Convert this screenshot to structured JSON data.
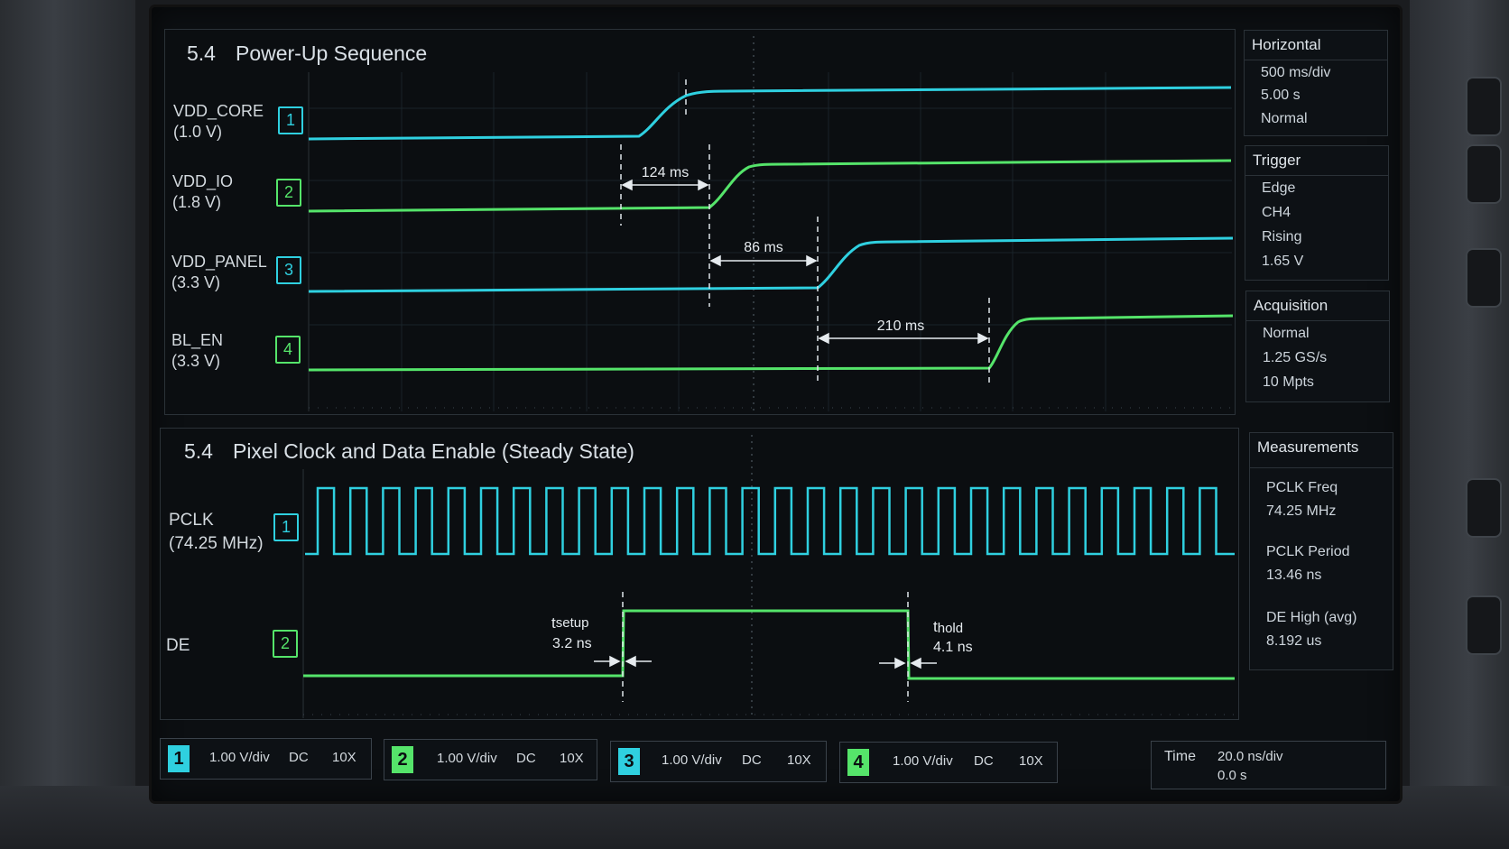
{
  "top_panel": {
    "section": "5.4",
    "title": "Power-Up Sequence",
    "channels": [
      {
        "name": "VDD_CORE",
        "level": "(1.0 V)",
        "num": "1",
        "color": "#2fd0e0"
      },
      {
        "name": "VDD_IO",
        "level": "(1.8 V)",
        "num": "2",
        "color": "#55e46a"
      },
      {
        "name": "VDD_PANEL",
        "level": "(3.3 V)",
        "num": "3",
        "color": "#2fd0e0"
      },
      {
        "name": "BL_EN",
        "level": "(3.3 V)",
        "num": "4",
        "color": "#55e46a"
      }
    ],
    "delays": [
      "124 ms",
      "86 ms",
      "210 ms"
    ]
  },
  "bottom_panel": {
    "section": "5.4",
    "title": "Pixel Clock and Data Enable (Steady State)",
    "pclk": {
      "name": "PCLK",
      "freq": "(74.25 MHz)",
      "num": "1"
    },
    "de": {
      "name": "DE",
      "num": "2"
    },
    "setup": {
      "label_t": "t",
      "label_sub": "setup",
      "value": "3.2 ns"
    },
    "hold": {
      "label_t": "t",
      "label_sub": "hold",
      "value": "4.1 ns"
    }
  },
  "horizontal": {
    "head": "Horizontal",
    "scale": "500 ms/div",
    "position": "5.00 s",
    "mode": "Normal"
  },
  "trigger": {
    "head": "Trigger",
    "type": "Edge",
    "source": "CH4",
    "slope": "Rising",
    "level": "1.65 V"
  },
  "acquisition": {
    "head": "Acquisition",
    "mode": "Normal",
    "rate": "1.25 GS/s",
    "depth": "10 Mpts"
  },
  "measurements": {
    "head": "Measurements",
    "items": [
      {
        "name": "PCLK Freq",
        "value": "74.25 MHz"
      },
      {
        "name": "PCLK Period",
        "value": "13.46 ns"
      },
      {
        "name": "DE High (avg)",
        "value": "8.192 us"
      }
    ]
  },
  "channel_bar": [
    {
      "num": "1",
      "scale": "1.00 V/div",
      "coupling": "DC",
      "probe": "10X",
      "color": "#2fd0e0"
    },
    {
      "num": "2",
      "scale": "1.00 V/div",
      "coupling": "DC",
      "probe": "10X",
      "color": "#55e46a"
    },
    {
      "num": "3",
      "scale": "1.00 V/div",
      "coupling": "DC",
      "probe": "10X",
      "color": "#2fd0e0"
    },
    {
      "num": "4",
      "scale": "1.00 V/div",
      "coupling": "DC",
      "probe": "10X",
      "color": "#55e46a"
    }
  ],
  "timebase": {
    "label": "Time",
    "scale": "20.0 ns/div",
    "offset": "0.0 s"
  }
}
